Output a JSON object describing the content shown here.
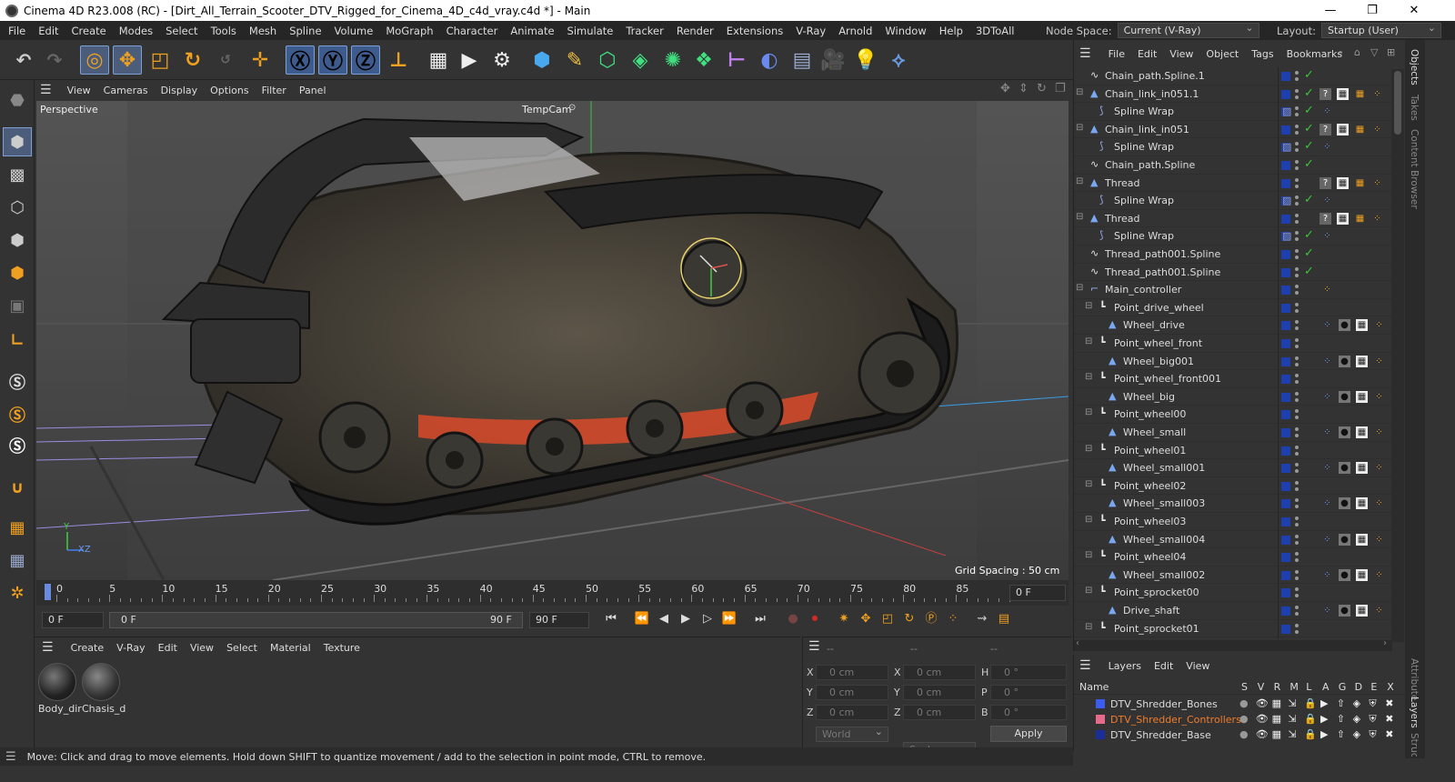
{
  "title_bar": {
    "title": "Cinema 4D R23.008 (RC) - [Dirt_All_Terrain_Scooter_DTV_Rigged_for_Cinema_4D_c4d_vray.c4d *] - Main",
    "minimize": "—",
    "maximize": "❐",
    "close": "✕"
  },
  "menu": {
    "items": [
      "File",
      "Edit",
      "Create",
      "Modes",
      "Select",
      "Tools",
      "Mesh",
      "Spline",
      "Volume",
      "MoGraph",
      "Character",
      "Animate",
      "Simulate",
      "Tracker",
      "Render",
      "Extensions",
      "V-Ray",
      "Arnold",
      "Window",
      "Help",
      "3DToAll"
    ],
    "node_space_label": "Node Space:",
    "node_space_value": "Current (V-Ray)",
    "layout_label": "Layout:",
    "layout_value": "Startup (User)"
  },
  "viewport": {
    "menu": [
      "View",
      "Cameras",
      "Display",
      "Options",
      "Filter",
      "Panel"
    ],
    "label": "Perspective",
    "camera": "TempCam",
    "grid_spacing": "Grid Spacing : 50 cm",
    "axis_y": "Y",
    "axis_xz": "XZ"
  },
  "timeline": {
    "ticks": [
      "0",
      "5",
      "10",
      "15",
      "20",
      "25",
      "30",
      "35",
      "40",
      "45",
      "50",
      "55",
      "60",
      "65",
      "70",
      "75",
      "80",
      "85",
      "90"
    ],
    "current_frame": "0 F",
    "start_field": "0 F",
    "range_start": "0 F",
    "range_end": "90 F",
    "end_field": "90 F"
  },
  "material_panel": {
    "menu": [
      "Create",
      "V-Ray",
      "Edit",
      "View",
      "Select",
      "Material",
      "Texture"
    ],
    "materials": [
      {
        "name": "Body_dir"
      },
      {
        "name": "Chasis_d"
      }
    ]
  },
  "coord_panel": {
    "headers": [
      "--",
      "--",
      "--"
    ],
    "rows": [
      {
        "a": "X",
        "av": "0 cm",
        "b": "X",
        "bv": "0 cm",
        "c": "H",
        "cv": "0 °"
      },
      {
        "a": "Y",
        "av": "0 cm",
        "b": "Y",
        "bv": "0 cm",
        "c": "P",
        "cv": "0 °"
      },
      {
        "a": "Z",
        "av": "0 cm",
        "b": "Z",
        "bv": "0 cm",
        "c": "B",
        "cv": "0 °"
      }
    ],
    "world": "World",
    "scale": "Scale",
    "apply": "Apply"
  },
  "status": {
    "text": "Move: Click and drag to move elements. Hold down SHIFT to quantize movement / add to the selection in point mode, CTRL to remove."
  },
  "object_manager": {
    "menu": [
      "File",
      "Edit",
      "View",
      "Object",
      "Tags",
      "Bookmarks"
    ],
    "rows": [
      {
        "name": "Chain_path.Spline.1",
        "depth": 0,
        "kind": "spline",
        "check": true,
        "tags": ""
      },
      {
        "name": "Chain_link_in051.1",
        "depth": 0,
        "kind": "mesh",
        "check": true,
        "tags": "full"
      },
      {
        "name": "Spline Wrap",
        "depth": 1,
        "kind": "wrap",
        "check": true,
        "tags": "wrap"
      },
      {
        "name": "Chain_link_in051",
        "depth": 0,
        "kind": "mesh",
        "check": true,
        "tags": "full"
      },
      {
        "name": "Spline Wrap",
        "depth": 1,
        "kind": "wrap",
        "check": true,
        "tags": "wrap"
      },
      {
        "name": "Chain_path.Spline",
        "depth": 0,
        "kind": "spline",
        "check": true,
        "tags": ""
      },
      {
        "name": "Thread",
        "depth": 0,
        "kind": "mesh",
        "check": false,
        "tags": "full"
      },
      {
        "name": "Spline Wrap",
        "depth": 1,
        "kind": "wrap",
        "check": true,
        "tags": "wrap"
      },
      {
        "name": "Thread",
        "depth": 0,
        "kind": "mesh",
        "check": false,
        "tags": "full"
      },
      {
        "name": "Spline Wrap",
        "depth": 1,
        "kind": "wrap",
        "check": true,
        "tags": "wrap"
      },
      {
        "name": "Thread_path001.Spline",
        "depth": 0,
        "kind": "spline",
        "check": true,
        "tags": ""
      },
      {
        "name": "Thread_path001.Spline",
        "depth": 0,
        "kind": "spline",
        "check": true,
        "tags": ""
      },
      {
        "name": "Main_controller",
        "depth": 0,
        "kind": "null",
        "check": false,
        "tags": "ctrl"
      },
      {
        "name": "Point_drive_wheel",
        "depth": 1,
        "kind": "joint",
        "check": false,
        "tags": ""
      },
      {
        "name": "Wheel_drive",
        "depth": 2,
        "kind": "mesh",
        "check": false,
        "tags": "mat"
      },
      {
        "name": "Point_wheel_front",
        "depth": 1,
        "kind": "joint",
        "check": false,
        "tags": ""
      },
      {
        "name": "Wheel_big001",
        "depth": 2,
        "kind": "mesh",
        "check": false,
        "tags": "mat"
      },
      {
        "name": "Point_wheel_front001",
        "depth": 1,
        "kind": "joint",
        "check": false,
        "tags": ""
      },
      {
        "name": "Wheel_big",
        "depth": 2,
        "kind": "mesh",
        "check": false,
        "tags": "mat"
      },
      {
        "name": "Point_wheel00",
        "depth": 1,
        "kind": "joint",
        "check": false,
        "tags": ""
      },
      {
        "name": "Wheel_small",
        "depth": 2,
        "kind": "mesh",
        "check": false,
        "tags": "mat"
      },
      {
        "name": "Point_wheel01",
        "depth": 1,
        "kind": "joint",
        "check": false,
        "tags": ""
      },
      {
        "name": "Wheel_small001",
        "depth": 2,
        "kind": "mesh",
        "check": false,
        "tags": "mat"
      },
      {
        "name": "Point_wheel02",
        "depth": 1,
        "kind": "joint",
        "check": false,
        "tags": ""
      },
      {
        "name": "Wheel_small003",
        "depth": 2,
        "kind": "mesh",
        "check": false,
        "tags": "mat"
      },
      {
        "name": "Point_wheel03",
        "depth": 1,
        "kind": "joint",
        "check": false,
        "tags": ""
      },
      {
        "name": "Wheel_small004",
        "depth": 2,
        "kind": "mesh",
        "check": false,
        "tags": "mat"
      },
      {
        "name": "Point_wheel04",
        "depth": 1,
        "kind": "joint",
        "check": false,
        "tags": ""
      },
      {
        "name": "Wheel_small002",
        "depth": 2,
        "kind": "mesh",
        "check": false,
        "tags": "mat"
      },
      {
        "name": "Point_sprocket00",
        "depth": 1,
        "kind": "joint",
        "check": false,
        "tags": ""
      },
      {
        "name": "Drive_shaft",
        "depth": 2,
        "kind": "mesh",
        "check": false,
        "tags": "mat"
      },
      {
        "name": "Point_sprocket01",
        "depth": 1,
        "kind": "joint",
        "check": false,
        "tags": ""
      }
    ]
  },
  "layer_manager": {
    "menu": [
      "Layers",
      "Edit",
      "View"
    ],
    "name_header": "Name",
    "col_headers": [
      "S",
      "V",
      "R",
      "M",
      "L",
      "A",
      "G",
      "D",
      "E",
      "X"
    ],
    "layers": [
      {
        "name": "DTV_Shredder_Bones",
        "color": "#3a5cf0",
        "text_color": "#dddddd"
      },
      {
        "name": "DTV_Shredder_Controllers",
        "color": "#e86a8a",
        "text_color": "#f07c2c"
      },
      {
        "name": "DTV_Shredder_Base",
        "color": "#1a2e9a",
        "text_color": "#dddddd"
      }
    ]
  },
  "side_tabs": [
    "Objects",
    "Takes",
    "Content Browser",
    "Attributes",
    "Layers",
    "Structure"
  ],
  "icons": {
    "undo": "undo-icon",
    "redo": "redo-icon",
    "select": "live-selection-icon",
    "move": "move-icon",
    "scale": "scale-icon",
    "rotate": "rotate-icon",
    "last": "last-tool-icon",
    "add": "add-icon",
    "x": "x-axis-icon",
    "y": "y-axis-icon",
    "z": "z-axis-icon",
    "coord": "coordinate-system-icon"
  },
  "colors": {
    "accent": "#4b5d7a",
    "check": "#39c839",
    "layer_blue": "#1e3fb0",
    "record": "#d12a2a"
  }
}
